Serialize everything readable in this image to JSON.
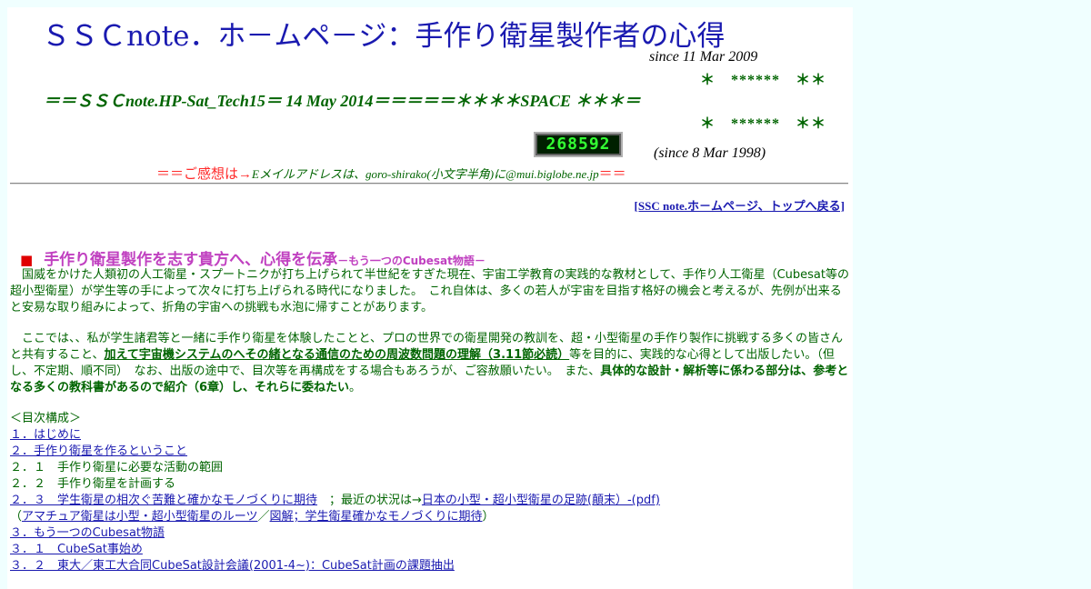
{
  "header": {
    "title": "ＳＳＣnote．ホ－ムペ－ジ：手作り衛星製作者の心得",
    "since_top": "since 11 Mar 2009",
    "stars_line1": "＊　******　＊＊",
    "subtitle": "＝＝ＳＳＣnote.HP-Sat_Tech15＝ 14 May 2014＝＝＝＝＝＊＊＊＊SPACE ＊＊＊＝",
    "stars_line2": "＊　******　＊＊",
    "counter_value": "268592",
    "since_counter": "(since 8 Mar 1998)",
    "feedback_prefix": "＝＝ご感想は→",
    "feedback_mail": "Eメイルアドレスは、goro-shirako(小文字半角)に@mui.biglobe.ne.jp",
    "feedback_suffix": "＝＝"
  },
  "nav": {
    "top_link": "[SSC note.ホ－ムペ－ジ、トップへ戻る]"
  },
  "section": {
    "bullet": "■",
    "heading": "手作り衛星製作を志す貴方へ、心得を伝承",
    "heading_small": "－もう一つのCubesat物語－"
  },
  "intro": {
    "p1": "　国威をかけた人類初の人工衛星・スプートニクが打ち上げられて半世紀をすぎた現在、宇宙工学教育の実践的な教材として、手作り人工衛星（Cubesat等の超小型衛星）が学生等の手によって次々に打ち上げられる時代になりました。　これ自体は、多くの若人が宇宙を目指す格好の機会と考えるが、先例が出来ると安易な取り組みによって、折角の宇宙への挑戦も水泡に帰すことがあります。",
    "p2_a": "　ここでは、、私が学生諸君等と一緒に手作り衛星を体験したことと、プロの世界での衛星開発の教訓を、超・小型衛星の手作り製作に挑戦する多くの皆さんと共有すること、",
    "p2_bold": "加えて宇宙機システムのへその緒となる通信のための周波数問題の理解（3.11節必読）",
    "p2_b": "等を目的に、実践的な心得として出版したい。（但し、不定期、順不同）　なお、出版の途中で、目次等を再構成をする場合もあろうが、ご容赦願いたい。　また、",
    "p2_bold2": "具体的な設計・解析等に係わる部分は、参考となる多くの教科書があるので紹介（6章）し、それらに委ねたい",
    "p2_end": "。"
  },
  "toc": {
    "label": "＜目次構成＞",
    "item1": "１．はじめに",
    "item2": "２．手作り衛星を作るということ",
    "item2_1": "２．１　手作り衛星に必要な活動の範囲",
    "item2_2": "２．２　手作り衛星を計画する",
    "item2_3": "２．３　学生衛星の相次ぐ苦難と確かなモノづくりに期待",
    "item2_3_note": "　；最近の状況は→",
    "item2_3_link": "日本の小型・超小型衛星の足跡(顛末）-(pdf)",
    "paren_open": "（",
    "amateur_link": "アマチュア衛星は小型・超小型衛星のルーツ",
    "slash": "／",
    "figure_link": "図解；学生衛星確かなモノづくりに期待",
    "paren_close": "）",
    "item3": "３．もう一つのCubesat物語",
    "item3_1": "３．１　CubeSat事始め",
    "item3_2": "３．２　東大／東工大合同CubeSat設計会議(2001-4~)：CubeSat計画の課題抽出"
  }
}
